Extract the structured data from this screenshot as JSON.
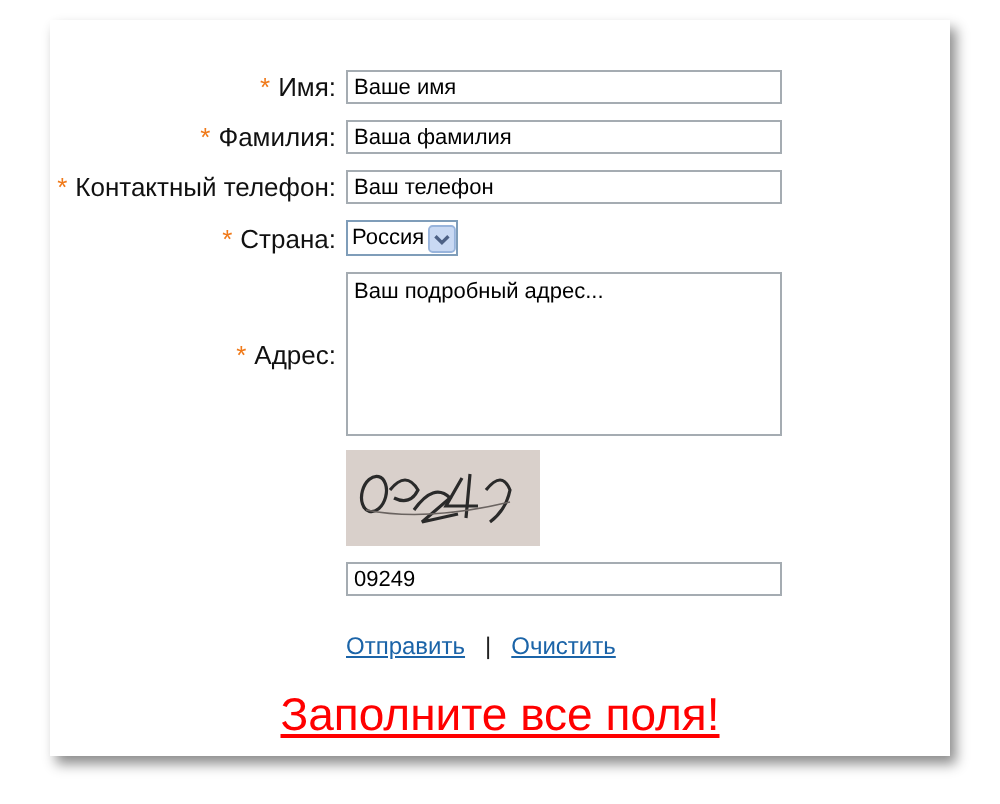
{
  "required_mark": "*",
  "fields": [
    {
      "kind": "text",
      "label": "Имя:",
      "required": true,
      "value": "Ваше имя"
    },
    {
      "kind": "text",
      "label": "Фамилия:",
      "required": true,
      "value": "Ваша фамилия"
    },
    {
      "kind": "text",
      "label": "Контактный телефон:",
      "required": true,
      "value": "Ваш телефон"
    },
    {
      "kind": "select",
      "label": "Страна:",
      "required": true,
      "value": "Россия"
    },
    {
      "kind": "textarea",
      "label": "Адрес:",
      "required": true,
      "value": "Ваш подробный адрес..."
    }
  ],
  "captcha": {
    "value": "09249"
  },
  "actions": [
    {
      "label": "Отправить"
    },
    {
      "label": "Очистить"
    }
  ],
  "separator": "|",
  "error": "Заполните все поля!"
}
